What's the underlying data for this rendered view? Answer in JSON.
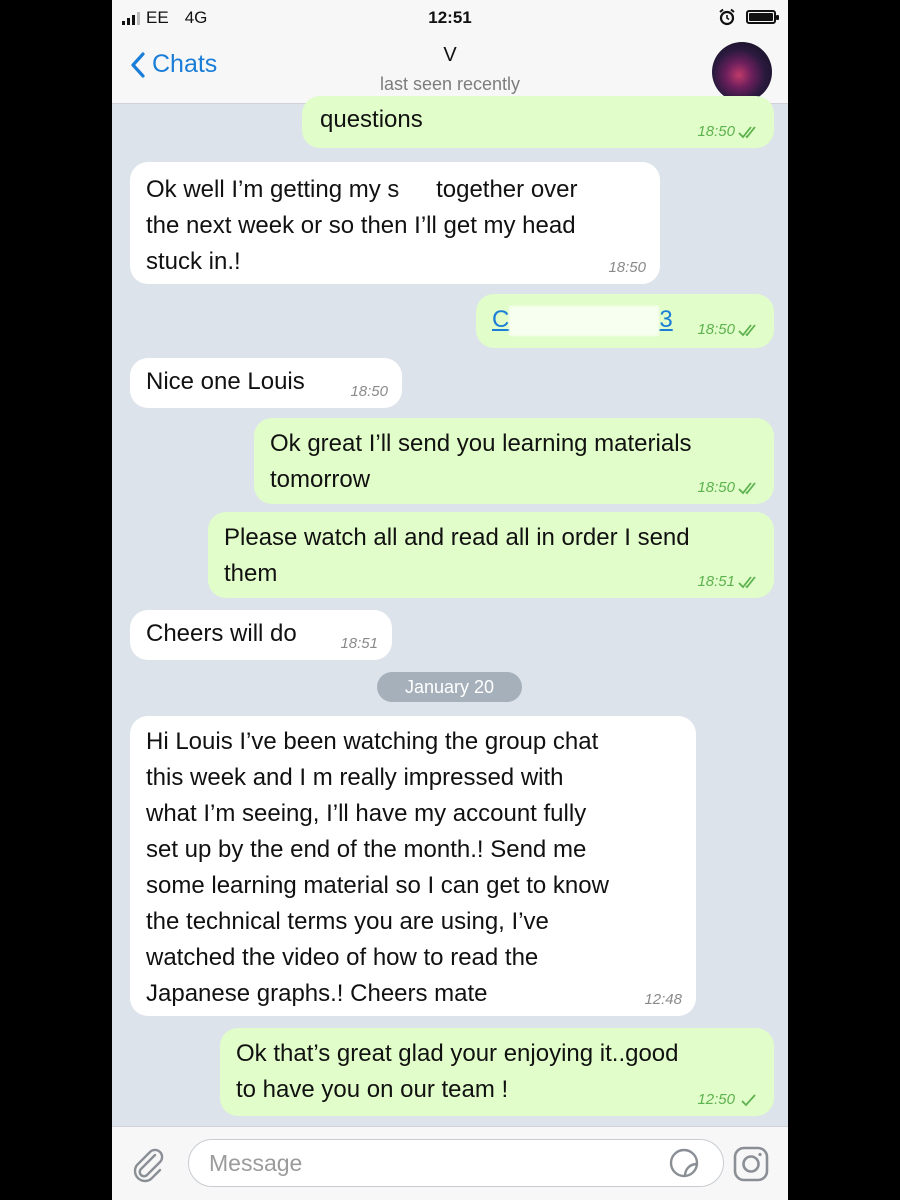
{
  "status_bar": {
    "carrier": "EE",
    "network": "4G",
    "time": "12:51"
  },
  "header": {
    "back_label": "Chats",
    "contact_name": "V",
    "last_seen": "last seen recently"
  },
  "messages": [
    {
      "direction": "out",
      "text": "questions",
      "time": "18:50",
      "status": "read"
    },
    {
      "direction": "in",
      "lines": [
        "Ok well I’m getting my s",
        "together over",
        "the next week or so then I’ll get my head",
        "stuck in.!"
      ],
      "time": "18:50"
    },
    {
      "direction": "out",
      "prefix": "C",
      "suffix": "3",
      "time": "18:50",
      "status": "read"
    },
    {
      "direction": "in",
      "text": "Nice one Louis",
      "time": "18:50"
    },
    {
      "direction": "out",
      "lines": [
        "Ok great I’ll send you learning materials",
        "tomorrow"
      ],
      "time": "18:50",
      "status": "read"
    },
    {
      "direction": "out",
      "lines": [
        "Please watch all and read all in order I send",
        "them"
      ],
      "time": "18:51",
      "status": "read"
    },
    {
      "direction": "in",
      "text": "Cheers will do",
      "time": "18:51"
    },
    {
      "direction": "in",
      "lines": [
        "Hi Louis I’ve been watching the group chat",
        "this week and I m really impressed with",
        "what I’m seeing, I’ll have my account fully",
        "set up by the end of the month.! Send me",
        "some learning material so I can get to know",
        "the technical terms you are using, I’ve",
        "watched the video of how to read the",
        "Japanese graphs.! Cheers mate"
      ],
      "time": "12:48"
    },
    {
      "direction": "out",
      "lines": [
        "Ok that’s great glad your enjoying it..good",
        "to have you on our team !"
      ],
      "time": "12:50",
      "status": "sent"
    }
  ],
  "date_separator": "January 20",
  "composer": {
    "placeholder": "Message"
  },
  "icons": {
    "back": "chevron-left-icon",
    "attach": "paperclip-icon",
    "sticker": "sticker-icon",
    "camera": "camera-icon",
    "read": "double-check-icon",
    "sent": "single-check-icon",
    "alarm": "alarm-icon",
    "battery": "battery-icon"
  },
  "colors": {
    "accent": "#1a7dd8",
    "outgoing_bubble": "#e1fdc9",
    "incoming_bubble": "#ffffff",
    "read_check": "#5db24f",
    "chat_background": "#dde3ea"
  }
}
